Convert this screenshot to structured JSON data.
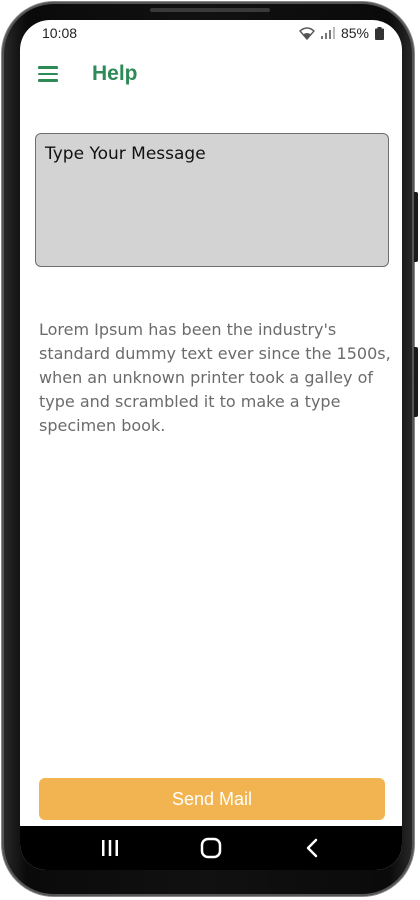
{
  "status_bar": {
    "time": "10:08",
    "battery": "85%",
    "icons": [
      "wifi-icon",
      "signal-icon",
      "battery-icon"
    ]
  },
  "app_bar": {
    "title": "Help",
    "menu_icon": "hamburger-menu-icon"
  },
  "form": {
    "message_placeholder": "Type Your Message",
    "message_value": ""
  },
  "info_text": "Lorem Ipsum has been the industry's standard dummy text ever since the 1500s, when an unknown printer took a galley of type and scrambled it to make a type specimen book.",
  "actions": {
    "send_label": "Send Mail"
  },
  "nav_bar": {
    "buttons": [
      "recent-apps-icon",
      "home-icon",
      "back-icon"
    ]
  },
  "colors": {
    "accent": "#2e8b57",
    "button": "#f2b451",
    "input_bg": "#d3d3d3",
    "text_muted": "#6b6b6b"
  }
}
